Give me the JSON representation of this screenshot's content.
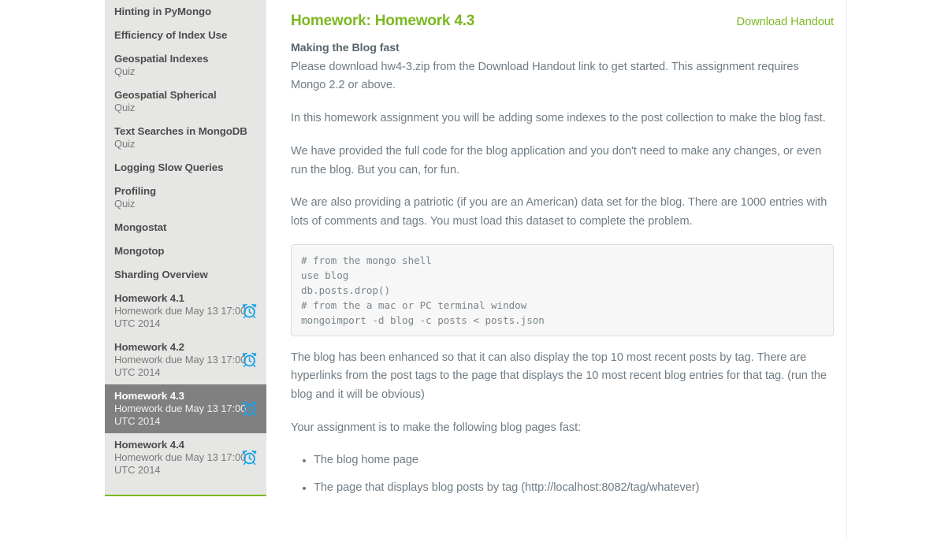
{
  "sidebar": {
    "items": [
      {
        "title": "Hinting in PyMongo",
        "sub": "",
        "icon": "",
        "selected": false
      },
      {
        "title": "Efficiency of Index Use",
        "sub": "",
        "icon": "",
        "selected": false
      },
      {
        "title": "Geospatial Indexes",
        "sub": "Quiz",
        "icon": "",
        "selected": false
      },
      {
        "title": "Geospatial Spherical",
        "sub": "Quiz",
        "icon": "",
        "selected": false
      },
      {
        "title": "Text Searches in MongoDB",
        "sub": "Quiz",
        "icon": "",
        "selected": false
      },
      {
        "title": "Logging Slow Queries",
        "sub": "",
        "icon": "",
        "selected": false
      },
      {
        "title": "Profiling",
        "sub": "Quiz",
        "icon": "",
        "selected": false
      },
      {
        "title": "Mongostat",
        "sub": "",
        "icon": "",
        "selected": false
      },
      {
        "title": "Mongotop",
        "sub": "",
        "icon": "",
        "selected": false
      },
      {
        "title": "Sharding Overview",
        "sub": "",
        "icon": "",
        "selected": false
      },
      {
        "title": "Homework 4.1",
        "sub": "Homework due May 13 17:00 UTC 2014",
        "icon": "alarm-clock-icon",
        "selected": false
      },
      {
        "title": "Homework 4.2",
        "sub": "Homework due May 13 17:00 UTC 2014",
        "icon": "alarm-clock-icon",
        "selected": false
      },
      {
        "title": "Homework 4.3",
        "sub": "Homework due May 13 17:00 UTC 2014",
        "icon": "alarm-clock-icon",
        "selected": true
      },
      {
        "title": "Homework 4.4",
        "sub": "Homework due May 13 17:00 UTC 2014",
        "icon": "alarm-clock-icon",
        "selected": false
      }
    ],
    "scrollbar": {
      "down_arrow": "chevron-down-icon"
    }
  },
  "main": {
    "title": "Homework: Homework 4.3",
    "download_link": "Download Handout",
    "subhead": "Making the Blog fast",
    "paragraphs": {
      "intro": "Please download hw4-3.zip from the Download Handout link to get started. This assignment requires Mongo 2.2 or above.",
      "p2": "In this homework assignment you will be adding some indexes to the post collection to make the blog fast.",
      "p3": "We have provided the full code for the blog application and you don't need to make any changes, or even run the blog. But you can, for fun.",
      "p4": "We are also providing a patriotic (if you are an American) data set for the blog. There are 1000 entries with lots of comments and tags. You must load this dataset to complete the problem.",
      "p5": "The blog has been enhanced so that it can also display the top 10 most recent posts by tag. There are hyperlinks from the post tags to the page that displays the 10 most recent blog entries for that tag. (run the blog and it will be obvious)",
      "p6": "Your assignment is to make the following blog pages fast:"
    },
    "code": "# from the mongo shell\nuse blog\ndb.posts.drop()\n# from the a mac or PC terminal window\nmongoimport -d blog -c posts < posts.json",
    "bullets": [
      "The blog home page",
      "The page that displays blog posts by tag (http://localhost:8082/tag/whatever)"
    ]
  },
  "colors": {
    "accent_green": "#7cb821",
    "text_body": "#6f7b83",
    "sidebar_bg": "#e6e6e4",
    "selected_bg": "#808080",
    "alarm_icon": "#1aa3e8"
  }
}
